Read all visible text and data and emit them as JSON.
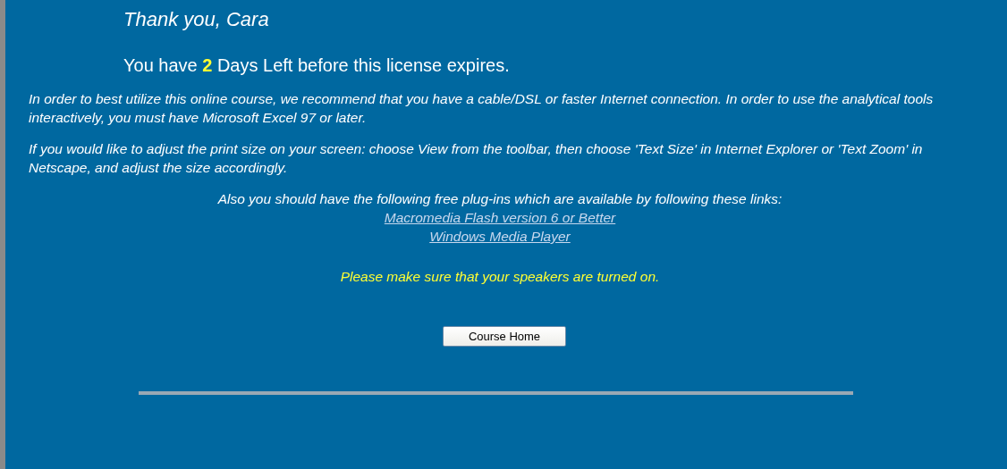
{
  "greeting": "Thank you, Cara",
  "license": {
    "prefix": "You have",
    "days": "2",
    "suffix": "Days Left before this license expires."
  },
  "paragraphs": [
    "In order to best utilize this online course, we recommend that you have a cable/DSL or faster Internet connection. In order to use the analytical tools interactively, you must have Microsoft Excel 97 or later.",
    "If you would like to adjust the print size on your screen: choose View from the toolbar, then choose 'Text Size' in Internet Explorer or 'Text Zoom' in Netscape, and adjust the size accordingly."
  ],
  "plugins": {
    "intro": "Also you should have the following free plug-ins which are available by following these links:",
    "links": [
      "Macromedia Flash version 6 or Better",
      "Windows Media Player"
    ]
  },
  "notice": "Please make sure that your speakers are turned on.",
  "button": "Course Home"
}
